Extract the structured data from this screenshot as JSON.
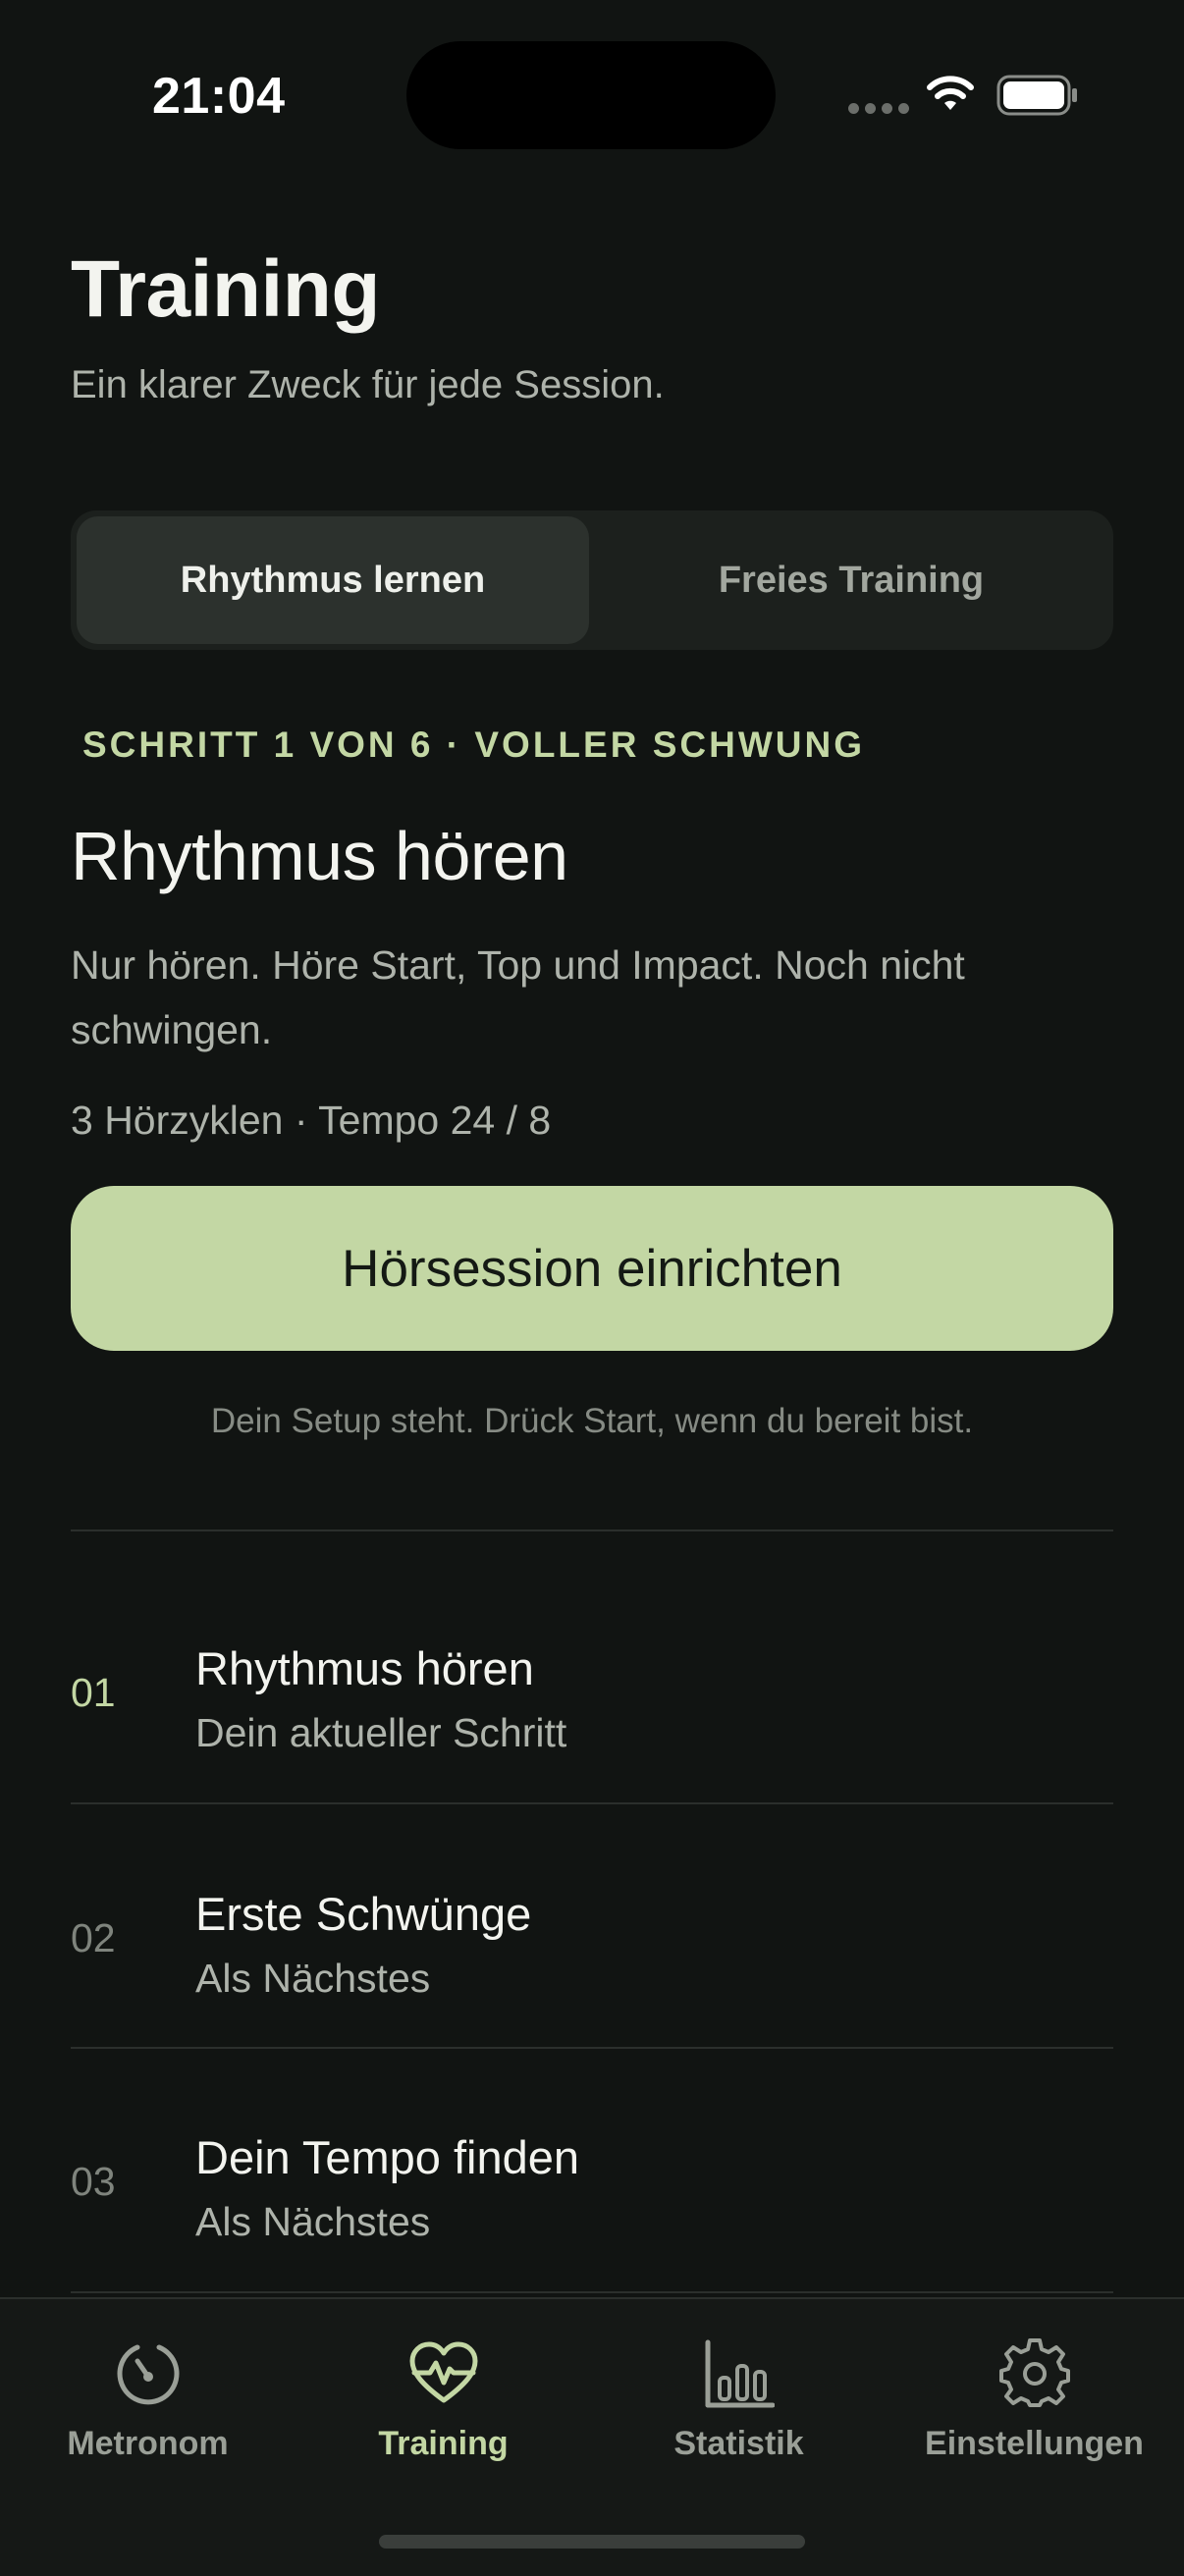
{
  "status_bar": {
    "time": "21:04"
  },
  "header": {
    "title": "Training",
    "subtitle": "Ein klarer Zweck für jede Session."
  },
  "segmented_control": {
    "options": [
      {
        "label": "Rhythmus lernen",
        "selected": true
      },
      {
        "label": "Freies Training",
        "selected": false
      }
    ]
  },
  "current_step": {
    "eyebrow": "SCHRITT 1 VON 6 · VOLLER SCHWUNG",
    "title": "Rhythmus hören",
    "description": "Nur hören. Höre Start, Top und Impact. Noch nicht schwingen.",
    "meta": "3 Hörzyklen · Tempo 24 / 8",
    "button_label": "Hörsession einrichten",
    "hint": "Dein Setup steht. Drück Start, wenn du bereit bist."
  },
  "steps": [
    {
      "number": "01",
      "title": "Rhythmus hören",
      "subtitle": "Dein aktueller Schritt",
      "current": true
    },
    {
      "number": "02",
      "title": "Erste Schwünge",
      "subtitle": "Als Nächstes",
      "current": false
    },
    {
      "number": "03",
      "title": "Dein Tempo finden",
      "subtitle": "Als Nächstes",
      "current": false
    }
  ],
  "tab_bar": {
    "items": [
      {
        "label": "Metronom",
        "icon": "metronome-dial-icon",
        "active": false
      },
      {
        "label": "Training",
        "icon": "heart-pulse-icon",
        "active": true
      },
      {
        "label": "Statistik",
        "icon": "bar-chart-icon",
        "active": false
      },
      {
        "label": "Einstellungen",
        "icon": "gear-icon",
        "active": false
      }
    ]
  },
  "colors": {
    "background": "#111412",
    "accent": "#c3d7a4",
    "text_primary": "#f3f4ef",
    "text_secondary": "#aeb3ab"
  }
}
